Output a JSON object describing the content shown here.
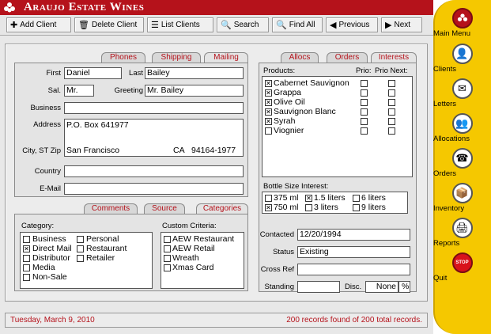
{
  "app": {
    "title": "Araujo Estate Wines"
  },
  "toolbar": {
    "add_client": "Add Client",
    "delete_client": "Delete Client",
    "list_clients": "List Clients",
    "search": "Search",
    "find_all": "Find All",
    "previous": "Previous",
    "next": "Next"
  },
  "sidebar": {
    "items": [
      {
        "label": "Main Menu",
        "icon": "wine-logo-icon"
      },
      {
        "label": "Clients",
        "icon": "client-icon"
      },
      {
        "label": "Letters",
        "icon": "letters-icon"
      },
      {
        "label": "Allocations",
        "icon": "allocations-icon"
      },
      {
        "label": "Orders",
        "icon": "orders-icon"
      },
      {
        "label": "Inventory",
        "icon": "inventory-icon"
      },
      {
        "label": "Reports",
        "icon": "reports-icon"
      },
      {
        "label": "Quit",
        "icon": "stop-icon",
        "glyph": "STOP"
      }
    ]
  },
  "address_tabs": {
    "phones": "Phones",
    "shipping": "Shipping",
    "mailing": "Mailing"
  },
  "mailing": {
    "first_label": "First",
    "first": "Daniel",
    "last_label": "Last",
    "last": "Bailey",
    "sal_label": "Sal.",
    "sal": "Mr.",
    "greeting_label": "Greeting",
    "greeting": "Mr. Bailey",
    "business_label": "Business",
    "business": "",
    "address_label": "Address",
    "address": "P.O. Box 641977",
    "city_label": "City, ST Zip",
    "city": "San Francisco",
    "state": "CA",
    "zip": "94164-1977",
    "country_label": "Country",
    "country": "",
    "email_label": "E-Mail",
    "email": ""
  },
  "lower_tabs": {
    "comments": "Comments",
    "source": "Source",
    "categories": "Categories"
  },
  "categories": {
    "category_label": "Category:",
    "left": [
      {
        "label": "Business",
        "checked": false
      },
      {
        "label": "Direct Mail",
        "checked": true
      },
      {
        "label": "Distributor",
        "checked": false
      },
      {
        "label": "Media",
        "checked": false
      },
      {
        "label": "Non-Sale",
        "checked": false
      }
    ],
    "right": [
      {
        "label": "Personal",
        "checked": false
      },
      {
        "label": "Restaurant",
        "checked": false
      },
      {
        "label": "Retailer",
        "checked": false
      }
    ],
    "custom_label": "Custom Criteria:",
    "custom": [
      {
        "label": "AEW Restaurant",
        "checked": false
      },
      {
        "label": "AEW Retail",
        "checked": false
      },
      {
        "label": "Wreath",
        "checked": false
      },
      {
        "label": "Xmas Card",
        "checked": false
      }
    ]
  },
  "right_tabs": {
    "allocs": "Allocs",
    "orders": "Orders",
    "interests": "Interests"
  },
  "interests": {
    "products_label": "Products:",
    "prio_label": "Prio:",
    "prio_next_label": "Prio Next:",
    "products": [
      {
        "label": "Cabernet Sauvignon",
        "checked": true
      },
      {
        "label": "Grappa",
        "checked": true
      },
      {
        "label": "Olive Oil",
        "checked": true
      },
      {
        "label": "Sauvignon Blanc",
        "checked": true
      },
      {
        "label": "Syrah",
        "checked": true
      },
      {
        "label": "Viognier",
        "checked": false
      }
    ],
    "bottle_label": "Bottle Size Interest:",
    "bottles": [
      {
        "label": "375 ml",
        "checked": false
      },
      {
        "label": "1.5 liters",
        "checked": true
      },
      {
        "label": "6 liters",
        "checked": false
      },
      {
        "label": "750 ml",
        "checked": true
      },
      {
        "label": "3 liters",
        "checked": false
      },
      {
        "label": "9 liters",
        "checked": false
      }
    ],
    "contacted_label": "Contacted",
    "contacted": "12/20/1994",
    "status_label": "Status",
    "status": "Existing",
    "crossref_label": "Cross Ref",
    "crossref": "",
    "standing_label": "Standing",
    "standing": "",
    "disc_label": "Disc.",
    "disc": "None",
    "disc_unit": "%"
  },
  "status_bar": {
    "date": "Tuesday, March 9, 2010",
    "records": "200 records found of 200 total records."
  }
}
